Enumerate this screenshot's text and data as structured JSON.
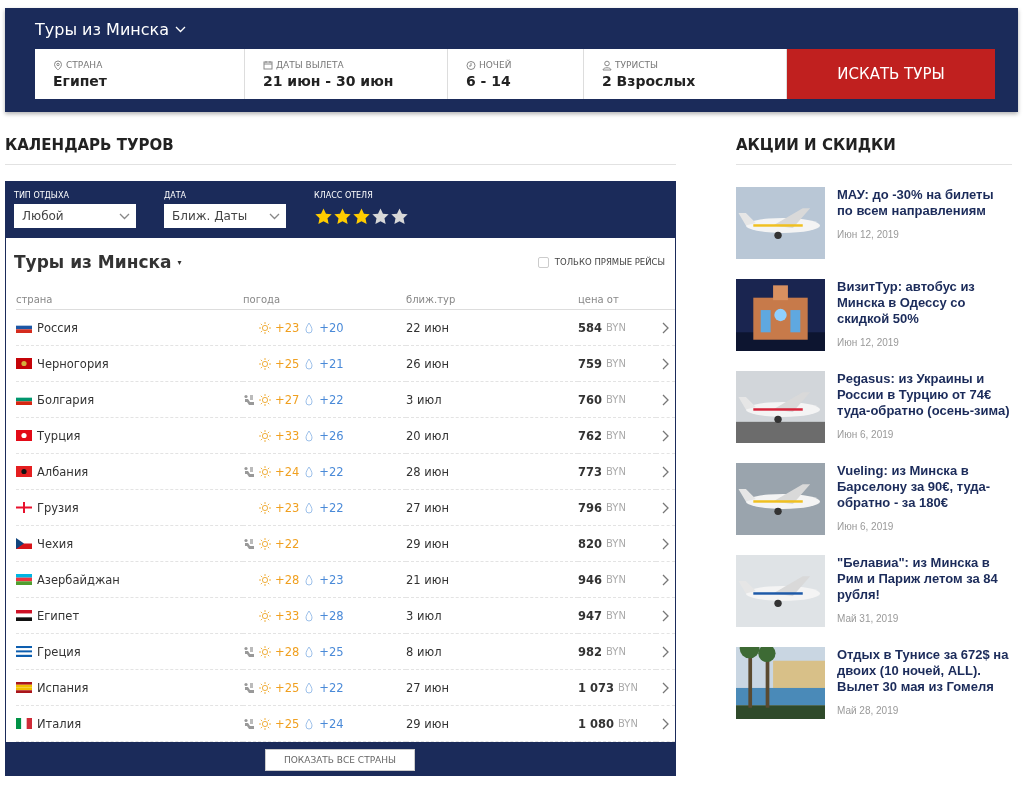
{
  "header": {
    "title": "Туры из Минска",
    "fields": [
      {
        "kind": "pin",
        "label": "СТРАНА",
        "value": "Египет"
      },
      {
        "kind": "calendar",
        "label": "ДАТЫ ВЫЛЕТА",
        "value": "21 июн - 30 июн"
      },
      {
        "kind": "clock",
        "label": "НОЧЕЙ",
        "value": "6 - 14"
      },
      {
        "kind": "person",
        "label": "ТУРИСТЫ",
        "value": "2 Взрослых"
      }
    ],
    "search_button": "ИСКАТЬ ТУРЫ"
  },
  "calendar": {
    "heading": "КАЛЕНДАРЬ ТУРОВ",
    "filters": {
      "type_label": "ТИП ОТДЫХА",
      "type_value": "Любой",
      "date_label": "ДАТА",
      "date_value": "Ближ. Даты",
      "class_label": "КЛАСС ОТЕЛЯ",
      "stars": 3
    },
    "title": "Туры из Минска",
    "title_caret": "▾",
    "direct_only": {
      "label": "ТОЛЬКО ПРЯМЫЕ РЕЙСЫ",
      "checked": false
    },
    "columns": [
      "страна",
      "погода",
      "ближ.тур",
      "цена от"
    ],
    "rows": [
      {
        "country": "Россия",
        "flag": {
          "kind": "h",
          "stripes": [
            {
              "color": "#ffffff"
            },
            {
              "color": "#1c57a5"
            },
            {
              "color": "#d52b1e"
            }
          ]
        },
        "swim": false,
        "air": "+23",
        "water": "+20",
        "date": "22 июн",
        "price": "584",
        "currency": "BYN"
      },
      {
        "country": "Черногория",
        "flag": {
          "kind": "emblem",
          "stripes": [
            {
              "color": "#c40308"
            },
            {
              "color": "#d4af3a"
            }
          ]
        },
        "swim": false,
        "air": "+25",
        "water": "+21",
        "date": "26 июн",
        "price": "759",
        "currency": "BYN"
      },
      {
        "country": "Болгария",
        "flag": {
          "kind": "h",
          "stripes": [
            {
              "color": "#ffffff"
            },
            {
              "color": "#00966e"
            },
            {
              "color": "#d62612"
            }
          ]
        },
        "swim": true,
        "air": "+27",
        "water": "+22",
        "date": "3 июл",
        "price": "760",
        "currency": "BYN"
      },
      {
        "country": "Турция",
        "flag": {
          "kind": "emblem",
          "stripes": [
            {
              "color": "#e30a17"
            },
            {
              "color": "#ffffff"
            }
          ]
        },
        "swim": false,
        "air": "+33",
        "water": "+26",
        "date": "20 июл",
        "price": "762",
        "currency": "BYN"
      },
      {
        "country": "Албания",
        "flag": {
          "kind": "emblem",
          "stripes": [
            {
              "color": "#e41e20"
            },
            {
              "color": "#111111"
            }
          ]
        },
        "swim": true,
        "air": "+24",
        "water": "+22",
        "date": "28 июн",
        "price": "773",
        "currency": "BYN"
      },
      {
        "country": "Грузия",
        "flag": {
          "kind": "cross",
          "stripes": [
            {
              "color": "#ffffff"
            },
            {
              "color": "#e8112d"
            }
          ]
        },
        "swim": false,
        "air": "+23",
        "water": "+22",
        "date": "27 июн",
        "price": "796",
        "currency": "BYN"
      },
      {
        "country": "Чехия",
        "flag": {
          "kind": "chevron",
          "stripes": [
            {
              "color": "#ffffff"
            },
            {
              "color": "#d7141a"
            },
            {
              "color": "#11457e"
            }
          ]
        },
        "swim": true,
        "air": "+22",
        "date": "29 июн",
        "price": "820",
        "currency": "BYN"
      },
      {
        "country": "Азербайджан",
        "flag": {
          "kind": "h",
          "stripes": [
            {
              "color": "#00b5e2"
            },
            {
              "color": "#ef3340"
            },
            {
              "color": "#509e2f"
            }
          ]
        },
        "swim": false,
        "air": "+28",
        "water": "+23",
        "date": "21 июн",
        "price": "946",
        "currency": "BYN"
      },
      {
        "country": "Египет",
        "flag": {
          "kind": "h",
          "stripes": [
            {
              "color": "#ce1126"
            },
            {
              "color": "#ffffff"
            },
            {
              "color": "#111111"
            }
          ]
        },
        "swim": false,
        "air": "+33",
        "water": "+28",
        "date": "3 июл",
        "price": "947",
        "currency": "BYN"
      },
      {
        "country": "Греция",
        "flag": {
          "kind": "h",
          "stripes": [
            {
              "color": "#0d5eaf"
            },
            {
              "color": "#ffffff"
            },
            {
              "color": "#0d5eaf"
            },
            {
              "color": "#ffffff"
            },
            {
              "color": "#0d5eaf"
            }
          ]
        },
        "swim": true,
        "air": "+28",
        "water": "+25",
        "date": "8 июл",
        "price": "982",
        "currency": "BYN"
      },
      {
        "country": "Испания",
        "flag": {
          "kind": "h",
          "stripes": [
            {
              "color": "#aa151b"
            },
            {
              "color": "#f1bf00"
            },
            {
              "color": "#f1bf00"
            },
            {
              "color": "#aa151b"
            }
          ]
        },
        "swim": true,
        "air": "+25",
        "water": "+22",
        "date": "27 июн",
        "price": "1 073",
        "currency": "BYN"
      },
      {
        "country": "Италия",
        "flag": {
          "kind": "v",
          "stripes": [
            {
              "color": "#009246"
            },
            {
              "color": "#ffffff"
            },
            {
              "color": "#ce2b37"
            }
          ]
        },
        "swim": true,
        "air": "+25",
        "water": "+24",
        "date": "29 июн",
        "price": "1 080",
        "currency": "BYN"
      }
    ],
    "show_all_button": "ПОКАЗАТЬ ВСЕ СТРАНЫ"
  },
  "promos": {
    "heading": "АКЦИИ И СКИДКИ",
    "items": [
      {
        "kind": "picture",
        "title": "МАУ: до -30% на билеты по всем направлениям",
        "date": "Июн 12, 2019"
      },
      {
        "kind": "picture",
        "title": "ВизитТур: автобус из Минска в Одессу со скидкой 50%",
        "date": "Июн 12, 2019"
      },
      {
        "kind": "picture",
        "title": "Pegasus: из Украины и России в Турцию от 74€ туда-обратно (осень-зима)",
        "date": "Июн 6, 2019"
      },
      {
        "kind": "picture",
        "title": "Vueling: из Минска в Барселону за 90€, туда-обратно - за 180€",
        "date": "Июн 6, 2019"
      },
      {
        "kind": "picture",
        "title": "\"Белавиа\": из Минска в Рим и Париж летом за 84 рубля!",
        "date": "Май 31, 2019"
      },
      {
        "kind": "picture",
        "title": "Отдых в Тунисе за 672$ на двоих (10 ночей, ALL). Вылет 30 мая из Гомеля",
        "date": "Май 28, 2019"
      }
    ]
  }
}
